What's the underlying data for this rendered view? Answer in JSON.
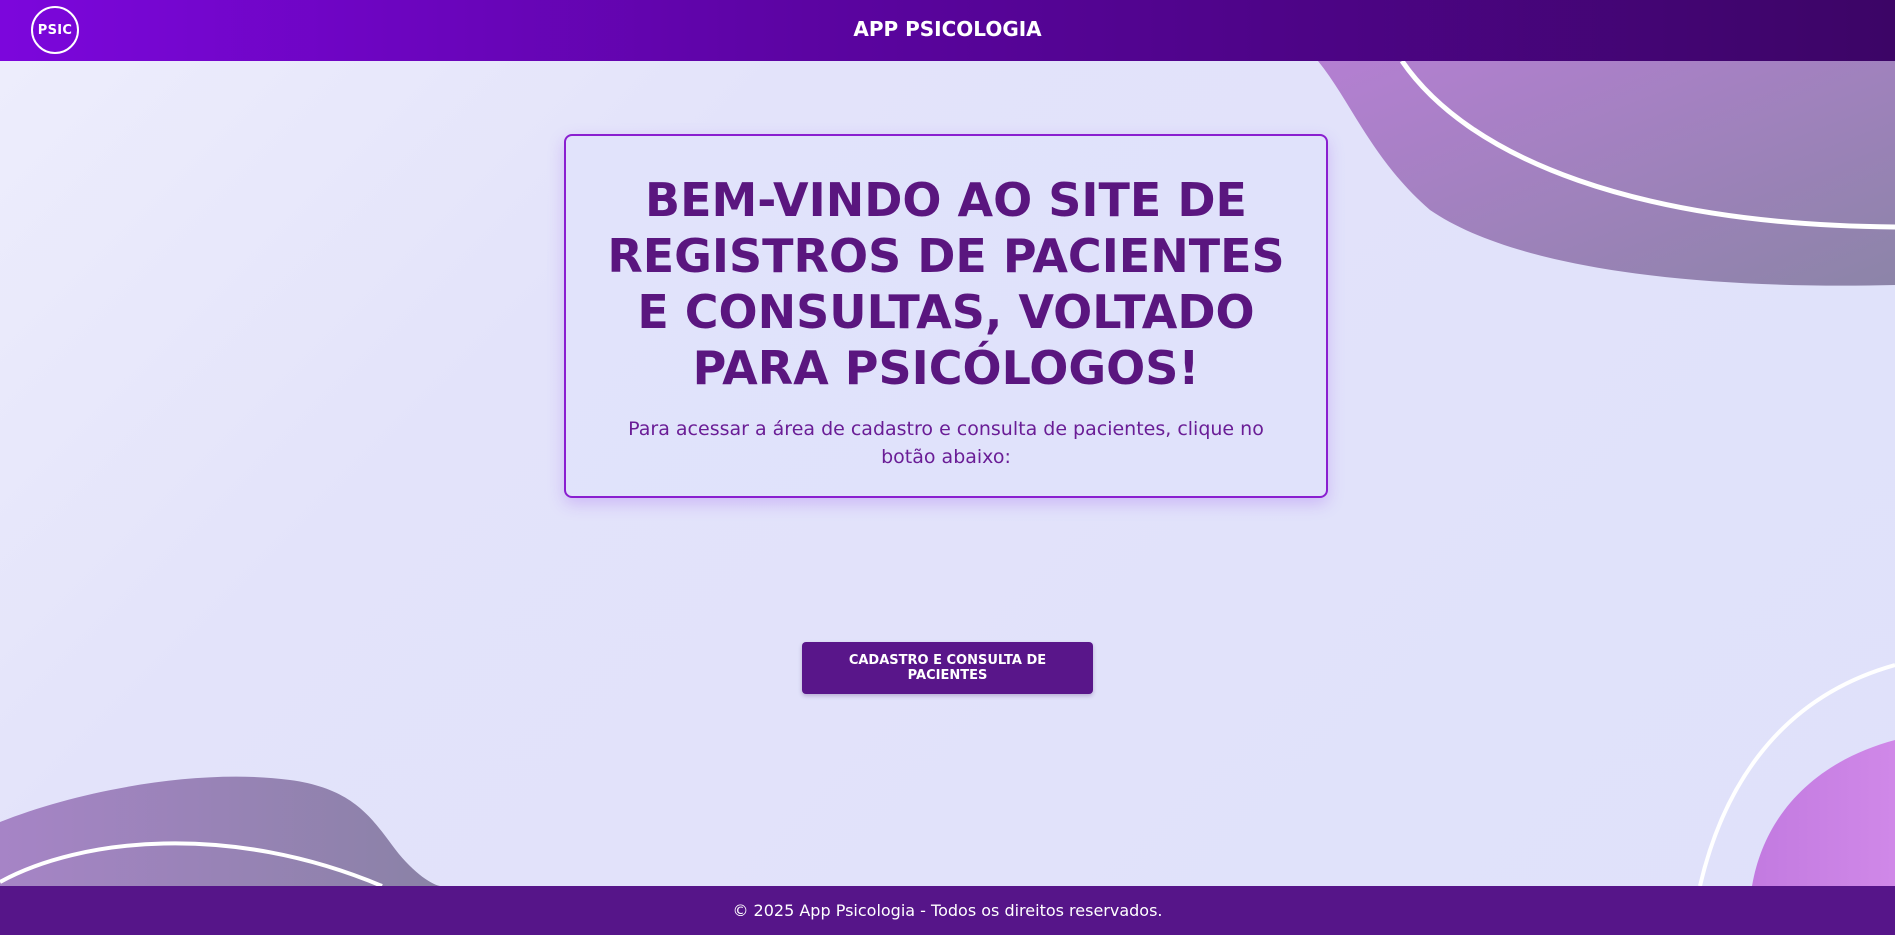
{
  "header": {
    "logo_text": "PSIC",
    "title": "APP PSICOLOGIA"
  },
  "welcome": {
    "heading": "BEM-VINDO AO SITE DE REGISTROS DE PACIENTES E CONSULTAS, VOLTADO PARA PSICÓLOGOS!",
    "description": "Para acessar a área de cadastro e consulta de pacientes, clique no botão abaixo:"
  },
  "cta": {
    "label": "CADASTRO E CONSULTA DE PACIENTES"
  },
  "footer": {
    "text": "© 2025 App Psicologia - Todos os direitos reservados."
  },
  "colors": {
    "header_start": "#7c06dc",
    "header_end": "#3c0566",
    "primary": "#59168a",
    "heading": "#5a167f",
    "background": "#e3e3fa"
  }
}
